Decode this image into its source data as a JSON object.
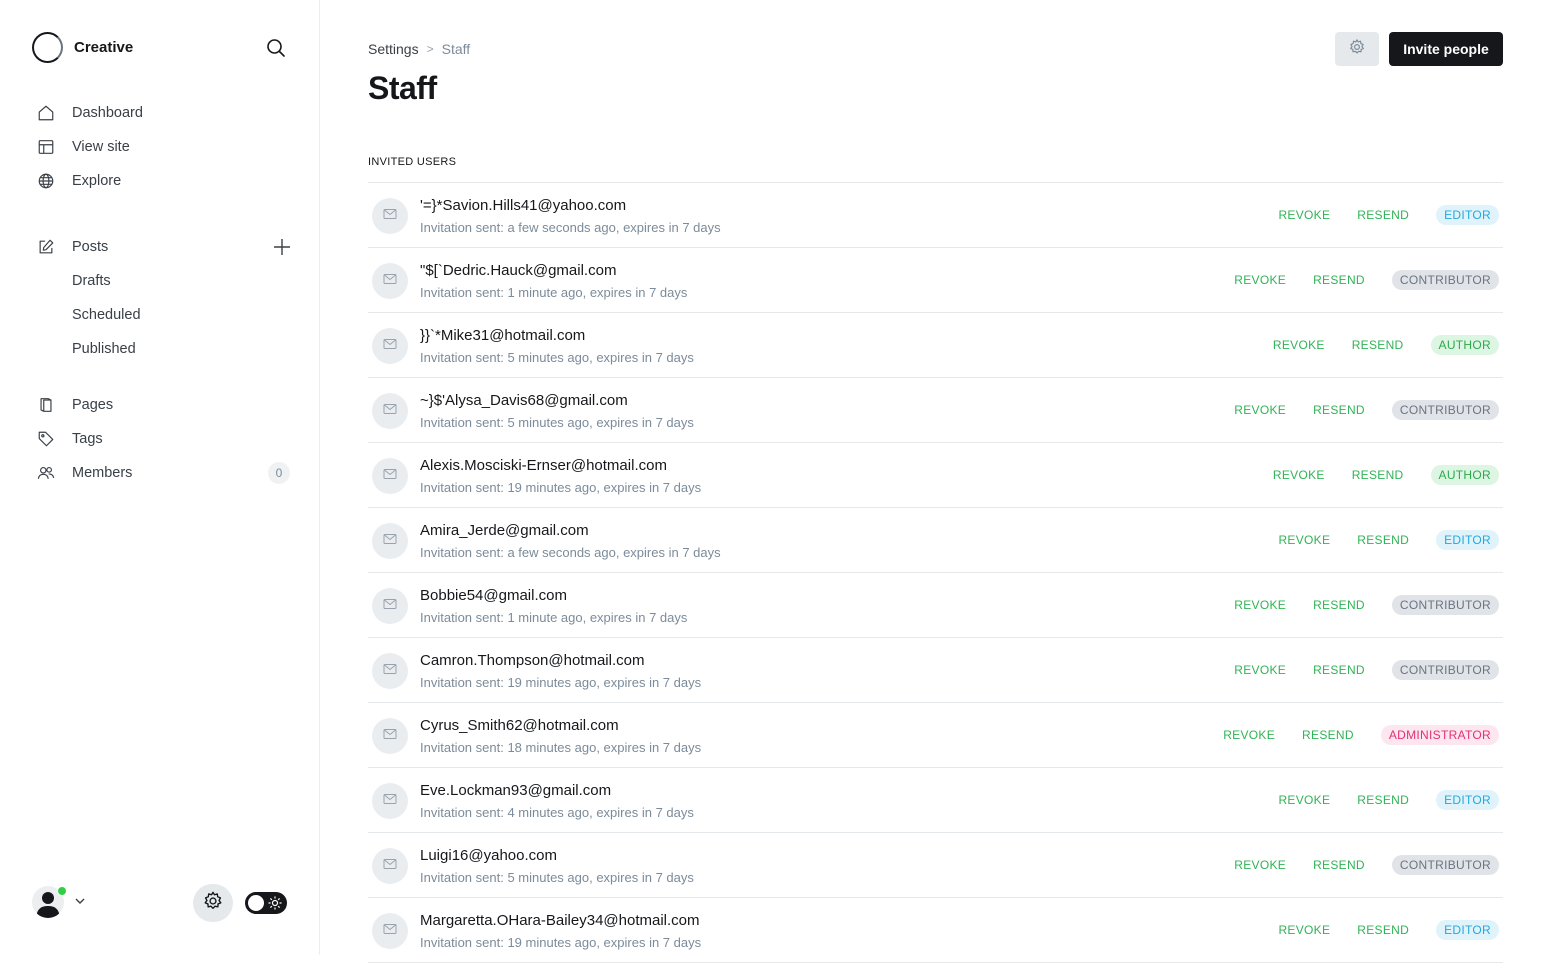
{
  "sidebar": {
    "site_name": "Creative",
    "nav_main": [
      {
        "label": "Dashboard",
        "icon": "house-icon"
      },
      {
        "label": "View site",
        "icon": "layout-icon"
      },
      {
        "label": "Explore",
        "icon": "globe-icon"
      }
    ],
    "posts": {
      "label": "Posts",
      "icon": "pencil-square-icon"
    },
    "post_subitems": [
      "Drafts",
      "Scheduled",
      "Published"
    ],
    "nav_secondary": [
      {
        "label": "Pages",
        "icon": "page-icon"
      },
      {
        "label": "Tags",
        "icon": "tag-icon"
      },
      {
        "label": "Members",
        "icon": "members-icon",
        "count": "0"
      }
    ]
  },
  "header": {
    "breadcrumb_parent": "Settings",
    "breadcrumb_separator": ">",
    "breadcrumb_current": "Staff",
    "title": "Staff",
    "invite_label": "Invite people"
  },
  "section_title": "INVITED USERS",
  "actions": {
    "revoke": "REVOKE",
    "resend": "RESEND"
  },
  "invites": [
    {
      "email": "'=}*Savion.Hills41@yahoo.com",
      "meta": "Invitation sent: a few seconds ago, expires in 7 days",
      "role": "EDITOR"
    },
    {
      "email": "\"$[`Dedric.Hauck@gmail.com",
      "meta": "Invitation sent: 1 minute ago, expires in 7 days",
      "role": "CONTRIBUTOR"
    },
    {
      "email": "}}`*Mike31@hotmail.com",
      "meta": "Invitation sent: 5 minutes ago, expires in 7 days",
      "role": "AUTHOR"
    },
    {
      "email": "~}$'Alysa_Davis68@gmail.com",
      "meta": "Invitation sent: 5 minutes ago, expires in 7 days",
      "role": "CONTRIBUTOR"
    },
    {
      "email": "Alexis.Mosciski-Ernser@hotmail.com",
      "meta": "Invitation sent: 19 minutes ago, expires in 7 days",
      "role": "AUTHOR"
    },
    {
      "email": "Amira_Jerde@gmail.com",
      "meta": "Invitation sent: a few seconds ago, expires in 7 days",
      "role": "EDITOR"
    },
    {
      "email": "Bobbie54@gmail.com",
      "meta": "Invitation sent: 1 minute ago, expires in 7 days",
      "role": "CONTRIBUTOR"
    },
    {
      "email": "Camron.Thompson@hotmail.com",
      "meta": "Invitation sent: 19 minutes ago, expires in 7 days",
      "role": "CONTRIBUTOR"
    },
    {
      "email": "Cyrus_Smith62@hotmail.com",
      "meta": "Invitation sent: 18 minutes ago, expires in 7 days",
      "role": "ADMINISTRATOR"
    },
    {
      "email": "Eve.Lockman93@gmail.com",
      "meta": "Invitation sent: 4 minutes ago, expires in 7 days",
      "role": "EDITOR"
    },
    {
      "email": "Luigi16@yahoo.com",
      "meta": "Invitation sent: 5 minutes ago, expires in 7 days",
      "role": "CONTRIBUTOR"
    },
    {
      "email": "Margaretta.OHara-Bailey34@hotmail.com",
      "meta": "Invitation sent: 19 minutes ago, expires in 7 days",
      "role": "EDITOR"
    }
  ],
  "colors": {
    "action_green": "#30b356",
    "editor": "#25a8de",
    "contributor": "#6b7480",
    "author": "#2fa84f",
    "administrator": "#e3326f",
    "online": "#30cf43"
  }
}
